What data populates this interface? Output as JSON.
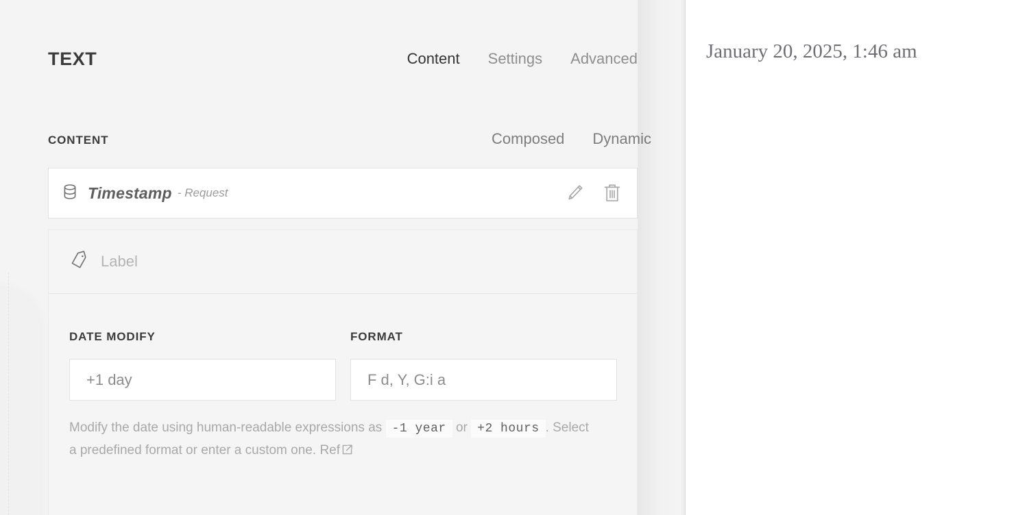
{
  "editor": {
    "title": "TEXT",
    "tabs": [
      {
        "label": "Content",
        "active": true
      },
      {
        "label": "Settings",
        "active": false
      },
      {
        "label": "Advanced",
        "active": false
      }
    ],
    "content_section": {
      "label": "CONTENT",
      "mode_tabs": [
        {
          "label": "Composed"
        },
        {
          "label": "Dynamic"
        }
      ],
      "dynamic_tag": {
        "icon": "database-icon",
        "name": "Timestamp",
        "source": "- Request",
        "edit_icon": "pencil-icon",
        "delete_icon": "trash-icon"
      },
      "label_field": {
        "icon": "tag-icon",
        "placeholder": "Label",
        "value": ""
      },
      "fields": [
        {
          "label": "DATE MODIFY",
          "name": "date-modify-input",
          "placeholder": "+1 day",
          "value": ""
        },
        {
          "label": "FORMAT",
          "name": "format-input",
          "placeholder": "F d, Y, G:i a",
          "value": ""
        }
      ],
      "help": {
        "part1": "Modify the date using human-readable expressions as",
        "code1": "-1 year",
        "part2": "or",
        "code2": "+2 hours",
        "part3": ". Select a predefined format or enter a custom one.",
        "ref_label": "Ref",
        "ref_icon": "external-link-icon"
      }
    }
  },
  "preview": {
    "date_text": "January 20, 2025, 1:46 am"
  },
  "colors": {
    "panel_bg": "#f4f4f4",
    "card_bg": "#f5f5f5",
    "input_bg": "#ffffff",
    "text_dark": "#3b3b3b",
    "text_muted": "#8e8e8e",
    "text_placeholder": "#b4b4b4",
    "border": "#e3e3e3"
  }
}
